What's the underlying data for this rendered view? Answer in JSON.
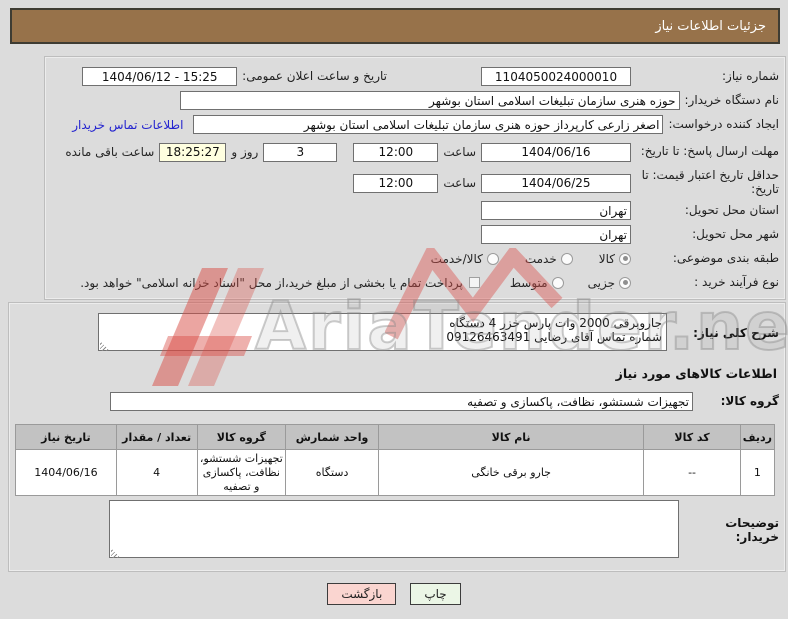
{
  "header": {
    "title": "جزئیات اطلاعات نیاز"
  },
  "form": {
    "need_number": {
      "label": "شماره نیاز:",
      "value": "1104050024000010"
    },
    "announce_datetime": {
      "label": "تاریخ و ساعت اعلان عمومی:",
      "value": "1404/06/12 - 15:25"
    },
    "buyer_org": {
      "label": "نام دستگاه خریدار:",
      "value": "حوزه هنری سازمان تبلیغات اسلامی استان بوشهر"
    },
    "request_creator": {
      "label": "ایجاد کننده درخواست:",
      "value": "اصغر زارعی کارپرداز حوزه هنری سازمان تبلیغات اسلامی استان بوشهر",
      "contact_link": "اطلاعات تماس خریدار"
    },
    "reply_deadline": {
      "label": "مهلت ارسال پاسخ: تا تاریخ:",
      "date": "1404/06/16",
      "time_label": "ساعت",
      "time": "12:00",
      "remaining_days": "3",
      "remaining_days_label": "روز و",
      "remaining_time": "18:25:27",
      "remaining_time_label": "ساعت باقی مانده"
    },
    "price_validity": {
      "label": "حداقل تاریخ اعتبار قیمت: تا تاریخ:",
      "date": "1404/06/25",
      "time_label": "ساعت",
      "time": "12:00"
    },
    "delivery_province": {
      "label": "استان محل تحویل:",
      "value": "تهران"
    },
    "delivery_city": {
      "label": "شهر محل تحویل:",
      "value": "تهران"
    },
    "subject_class": {
      "label": "طبقه بندی موضوعی:",
      "options": [
        {
          "label": "کالا",
          "selected": true
        },
        {
          "label": "خدمت",
          "selected": false
        },
        {
          "label": "کالا/خدمت",
          "selected": false
        }
      ]
    },
    "purchase_process": {
      "label": "نوع فرآیند خرید :",
      "options": [
        {
          "label": "جزیی",
          "selected": true
        },
        {
          "label": "متوسط",
          "selected": false
        }
      ],
      "treasury_checked": false,
      "treasury_note": "پرداخت تمام یا بخشی از مبلغ خرید،از محل \"اسناد خزانه اسلامی\" خواهد بود."
    }
  },
  "need_description": {
    "label": "شرح کلی نیاز:",
    "value": "جاروبرقی 2000 وات پارس خزر 4 دستگاه\nشماره تماس آقای رضایی 09126463491"
  },
  "goods_section": {
    "title": "اطلاعات کالاهای مورد نیاز",
    "group_label": "گروه کالا:",
    "group_value": "تجهیزات شستشو، نظافت، پاکسازی و تصفیه",
    "table": {
      "headers": [
        "ردیف",
        "کد کالا",
        "نام کالا",
        "واحد شمارش",
        "گروه کالا",
        "تعداد / مقدار",
        "تاریخ نیاز"
      ],
      "rows": [
        [
          "1",
          "--",
          "جارو برقی خانگی",
          "دستگاه",
          "تجهیزات شستشو، نظافت، پاکسازی و تصفیه",
          "4",
          "1404/06/16"
        ]
      ]
    }
  },
  "buyer_notes": {
    "label": "توضیحات خریدار:",
    "value": ""
  },
  "buttons": {
    "print": "چاپ",
    "back": "بازگشت"
  },
  "watermark": {
    "text": "AriaTender.neT"
  },
  "colors": {
    "header_bg": "#97724A",
    "link": "#2323CF",
    "countdown_bg": "#FFFFE0",
    "print_button_bg": "#EBF6E6",
    "back_button_bg": "#FAD5D0",
    "watermark_red": "#D84B44"
  }
}
